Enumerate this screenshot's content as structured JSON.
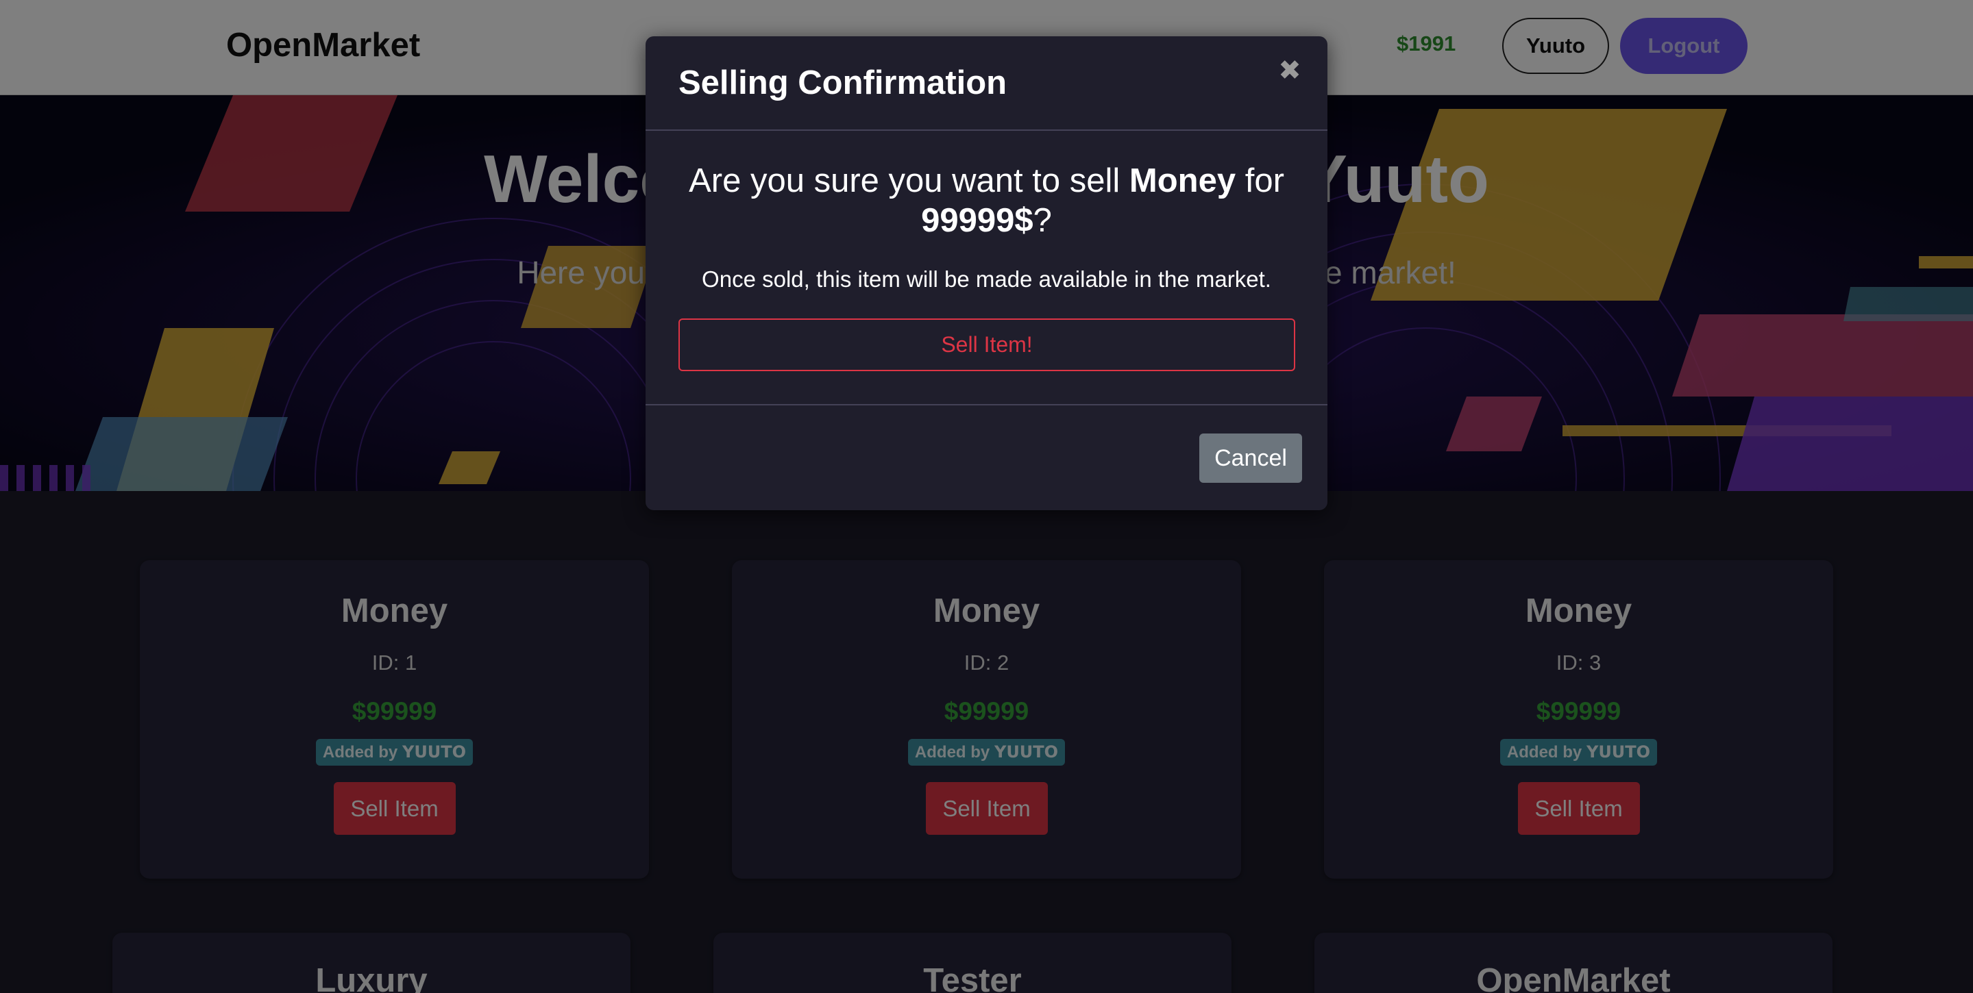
{
  "navbar": {
    "brand": "OpenMarket",
    "balance": "$1991",
    "username": "Yuuto",
    "logout_label": "Logout"
  },
  "hero": {
    "title": "Welcome to OpenMarket, Yuuto",
    "subtitle": "Here you can manage your items and add new items to the market!"
  },
  "items": [
    {
      "name": "Money",
      "id_label": "ID: 1",
      "price": "$99999",
      "added_by_prefix": "Added by",
      "added_by": "Yuuto",
      "sell_label": "Sell Item"
    },
    {
      "name": "Money",
      "id_label": "ID: 2",
      "price": "$99999",
      "added_by_prefix": "Added by",
      "added_by": "Yuuto",
      "sell_label": "Sell Item"
    },
    {
      "name": "Money",
      "id_label": "ID: 3",
      "price": "$99999",
      "added_by_prefix": "Added by",
      "added_by": "Yuuto",
      "sell_label": "Sell Item"
    },
    {
      "name": "Luxury"
    },
    {
      "name": "Tester"
    },
    {
      "name": "OpenMarket"
    }
  ],
  "modal": {
    "title": "Selling Confirmation",
    "close_icon": "close-icon",
    "question_prefix": "Are you sure you want to sell",
    "question_item": "Money",
    "question_mid": "for",
    "question_price": "99999$",
    "question_suffix": "?",
    "note": "Once sold, this item will be made available in the market.",
    "confirm_label": "Sell Item!",
    "cancel_label": "Cancel"
  },
  "colors": {
    "accent": "#6a55ea",
    "danger": "#dc3545",
    "success": "#37a43a",
    "badge": "#3c8fa0",
    "background": "#1c1b29"
  }
}
